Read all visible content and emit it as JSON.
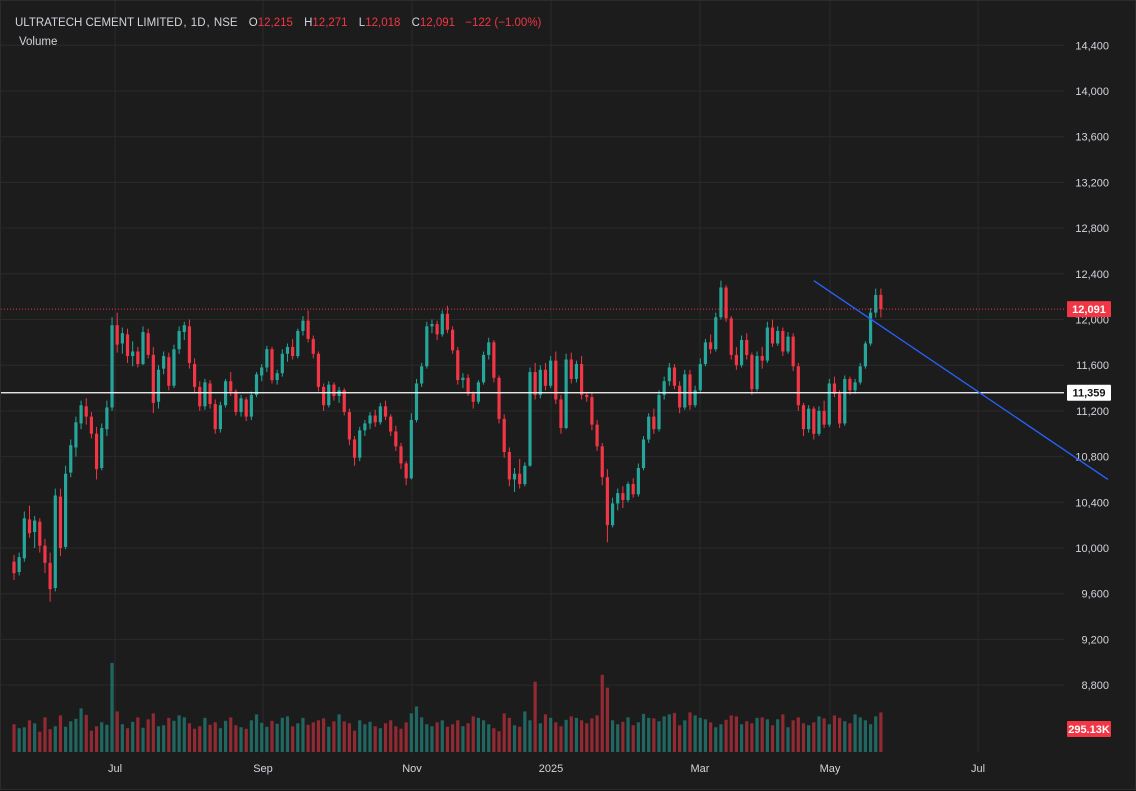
{
  "header": {
    "symbol": "ULTRATECH CEMENT LIMITED",
    "interval": "1D",
    "exchange": "NSE",
    "open_key": "O",
    "open": "12,215",
    "high_key": "H",
    "high": "12,271",
    "low_key": "L",
    "low": "12,018",
    "close_key": "C",
    "close": "12,091",
    "change": "−122 (−1.00%)",
    "volume_label": "Volume"
  },
  "badges": {
    "last_price": "12,091",
    "horizontal_line": "11,359",
    "volume": "295.13K"
  },
  "colors": {
    "up": "#26a69a",
    "down": "#f23645",
    "trendline": "#2962ff",
    "hline": "#ffffff",
    "background": "#1c1c1c",
    "grid": "#2a2a2a"
  },
  "chart_data": {
    "type": "candlestick",
    "title": "ULTRATECH CEMENT LIMITED, 1D, NSE",
    "ylabel": "",
    "xlabel": "",
    "ylim": [
      9000,
      14600
    ],
    "y_ticks": [
      "14,400",
      "14,000",
      "13,600",
      "13,200",
      "12,800",
      "12,400",
      "12,000",
      "11,600",
      "11,200",
      "10,800",
      "10,400",
      "10,000",
      "9,600",
      "9,200",
      "8,800"
    ],
    "x_ticks": [
      "Jul",
      "Sep",
      "Nov",
      "2025",
      "Mar",
      "May",
      "Jul"
    ],
    "last_close": 12091,
    "horizontal_line": 11359,
    "trendline": {
      "from": [
        155,
        12340
      ],
      "to": [
        212,
        10600
      ]
    },
    "grid": true,
    "candles": [
      [
        9880,
        9940,
        9720,
        9780
      ],
      [
        9790,
        9960,
        9760,
        9920
      ],
      [
        9910,
        10320,
        9880,
        10260
      ],
      [
        10250,
        10370,
        10090,
        10130
      ],
      [
        10140,
        10280,
        10000,
        10240
      ],
      [
        10230,
        10260,
        9960,
        10020
      ],
      [
        10020,
        10080,
        9780,
        9870
      ],
      [
        9870,
        9960,
        9530,
        9640
      ],
      [
        9650,
        10520,
        9620,
        10460
      ],
      [
        10450,
        10520,
        9930,
        10000
      ],
      [
        10010,
        10720,
        9990,
        10650
      ],
      [
        10660,
        10950,
        10620,
        10900
      ],
      [
        10880,
        11150,
        10800,
        11100
      ],
      [
        11090,
        11290,
        11040,
        11250
      ],
      [
        11240,
        11310,
        11080,
        11150
      ],
      [
        11150,
        11190,
        10960,
        11000
      ],
      [
        11000,
        11060,
        10600,
        10690
      ],
      [
        10700,
        11090,
        10680,
        11050
      ],
      [
        11040,
        11290,
        10980,
        11230
      ],
      [
        11230,
        12020,
        11200,
        11950
      ],
      [
        11950,
        12060,
        11710,
        11780
      ],
      [
        11790,
        11930,
        11700,
        11880
      ],
      [
        11870,
        11920,
        11620,
        11680
      ],
      [
        11680,
        11810,
        11590,
        11720
      ],
      [
        11720,
        11760,
        11580,
        11610
      ],
      [
        11610,
        11940,
        11600,
        11890
      ],
      [
        11880,
        11920,
        11660,
        11690
      ],
      [
        11690,
        11760,
        11180,
        11270
      ],
      [
        11280,
        11600,
        11220,
        11560
      ],
      [
        11570,
        11720,
        11520,
        11680
      ],
      [
        11670,
        11710,
        11380,
        11420
      ],
      [
        11420,
        11780,
        11400,
        11740
      ],
      [
        11740,
        11940,
        11700,
        11900
      ],
      [
        11890,
        11980,
        11820,
        11950
      ],
      [
        11940,
        12000,
        11570,
        11620
      ],
      [
        11610,
        11660,
        11360,
        11410
      ],
      [
        11410,
        11460,
        11200,
        11240
      ],
      [
        11240,
        11480,
        11210,
        11450
      ],
      [
        11440,
        11470,
        11220,
        11260
      ],
      [
        11260,
        11300,
        11000,
        11040
      ],
      [
        11040,
        11280,
        11010,
        11250
      ],
      [
        11250,
        11480,
        11230,
        11460
      ],
      [
        11460,
        11540,
        11330,
        11370
      ],
      [
        11370,
        11390,
        11160,
        11190
      ],
      [
        11190,
        11340,
        11150,
        11310
      ],
      [
        11300,
        11320,
        11110,
        11150
      ],
      [
        11150,
        11370,
        11120,
        11340
      ],
      [
        11340,
        11540,
        11320,
        11520
      ],
      [
        11510,
        11610,
        11460,
        11580
      ],
      [
        11580,
        11770,
        11540,
        11740
      ],
      [
        11740,
        11760,
        11440,
        11470
      ],
      [
        11470,
        11560,
        11430,
        11530
      ],
      [
        11530,
        11740,
        11500,
        11700
      ],
      [
        11700,
        11790,
        11630,
        11760
      ],
      [
        11760,
        11830,
        11650,
        11680
      ],
      [
        11680,
        11920,
        11660,
        11900
      ],
      [
        11900,
        12030,
        11860,
        11990
      ],
      [
        11990,
        12080,
        11800,
        11830
      ],
      [
        11830,
        11860,
        11660,
        11700
      ],
      [
        11700,
        11720,
        11370,
        11410
      ],
      [
        11410,
        11440,
        11200,
        11250
      ],
      [
        11250,
        11460,
        11230,
        11430
      ],
      [
        11430,
        11450,
        11290,
        11330
      ],
      [
        11330,
        11410,
        11270,
        11380
      ],
      [
        11380,
        11400,
        11160,
        11190
      ],
      [
        11190,
        11220,
        10900,
        10950
      ],
      [
        10950,
        10980,
        10720,
        10790
      ],
      [
        10790,
        11060,
        10760,
        11030
      ],
      [
        11030,
        11120,
        10980,
        11090
      ],
      [
        11090,
        11190,
        11040,
        11160
      ],
      [
        11160,
        11210,
        11060,
        11100
      ],
      [
        11100,
        11270,
        11080,
        11240
      ],
      [
        11240,
        11290,
        11120,
        11150
      ],
      [
        11150,
        11170,
        10980,
        11020
      ],
      [
        11020,
        11070,
        10850,
        10890
      ],
      [
        10890,
        10920,
        10690,
        10740
      ],
      [
        10740,
        10760,
        10550,
        10610
      ],
      [
        10610,
        11180,
        10600,
        11120
      ],
      [
        11120,
        11480,
        11100,
        11440
      ],
      [
        11440,
        11620,
        11410,
        11590
      ],
      [
        11590,
        11980,
        11570,
        11940
      ],
      [
        11940,
        12000,
        11880,
        11960
      ],
      [
        11960,
        11990,
        11820,
        11870
      ],
      [
        11870,
        12080,
        11850,
        12050
      ],
      [
        12050,
        12120,
        11880,
        11910
      ],
      [
        11910,
        11940,
        11700,
        11730
      ],
      [
        11730,
        11760,
        11430,
        11470
      ],
      [
        11470,
        11530,
        11400,
        11490
      ],
      [
        11490,
        11520,
        11330,
        11350
      ],
      [
        11350,
        11370,
        11220,
        11280
      ],
      [
        11280,
        11470,
        11260,
        11450
      ],
      [
        11450,
        11720,
        11430,
        11690
      ],
      [
        11690,
        11840,
        11650,
        11800
      ],
      [
        11800,
        11820,
        11450,
        11490
      ],
      [
        11490,
        11510,
        11090,
        11130
      ],
      [
        11130,
        11170,
        10790,
        10840
      ],
      [
        10840,
        10880,
        10540,
        10600
      ],
      [
        10600,
        10700,
        10490,
        10650
      ],
      [
        10650,
        10780,
        10520,
        10560
      ],
      [
        10560,
        10750,
        10540,
        10720
      ],
      [
        10720,
        11580,
        10710,
        11540
      ],
      [
        11540,
        11620,
        11300,
        11340
      ],
      [
        11340,
        11600,
        11310,
        11560
      ],
      [
        11560,
        11620,
        11380,
        11420
      ],
      [
        11420,
        11680,
        11400,
        11640
      ],
      [
        11640,
        11720,
        11260,
        11300
      ],
      [
        11300,
        11340,
        11000,
        11050
      ],
      [
        11050,
        11700,
        11040,
        11650
      ],
      [
        11650,
        11710,
        11440,
        11480
      ],
      [
        11480,
        11640,
        11450,
        11610
      ],
      [
        11610,
        11680,
        11300,
        11340
      ],
      [
        11340,
        11360,
        11280,
        11320
      ],
      [
        11320,
        11360,
        11030,
        11080
      ],
      [
        11080,
        11120,
        10850,
        10890
      ],
      [
        10890,
        10920,
        10550,
        10620
      ],
      [
        10620,
        10690,
        10050,
        10200
      ],
      [
        10200,
        10440,
        10180,
        10390
      ],
      [
        10390,
        10520,
        10330,
        10480
      ],
      [
        10480,
        10540,
        10350,
        10420
      ],
      [
        10420,
        10580,
        10400,
        10560
      ],
      [
        10560,
        10610,
        10440,
        10470
      ],
      [
        10470,
        10740,
        10450,
        10700
      ],
      [
        10700,
        10980,
        10680,
        10950
      ],
      [
        10950,
        11180,
        10920,
        11150
      ],
      [
        11150,
        11220,
        11000,
        11040
      ],
      [
        11040,
        11380,
        11020,
        11340
      ],
      [
        11340,
        11500,
        11300,
        11460
      ],
      [
        11460,
        11620,
        11420,
        11580
      ],
      [
        11580,
        11610,
        11390,
        11420
      ],
      [
        11420,
        11460,
        11180,
        11230
      ],
      [
        11230,
        11560,
        11210,
        11520
      ],
      [
        11520,
        11560,
        11210,
        11250
      ],
      [
        11250,
        11420,
        11230,
        11380
      ],
      [
        11380,
        11660,
        11360,
        11610
      ],
      [
        11610,
        11830,
        11590,
        11800
      ],
      [
        11800,
        11870,
        11700,
        11740
      ],
      [
        11740,
        12060,
        11720,
        12020
      ],
      [
        12020,
        12340,
        12000,
        12280
      ],
      [
        12280,
        12300,
        11980,
        12010
      ],
      [
        12010,
        12030,
        11650,
        11690
      ],
      [
        11690,
        11760,
        11560,
        11600
      ],
      [
        11600,
        11860,
        11580,
        11820
      ],
      [
        11820,
        11880,
        11650,
        11690
      ],
      [
        11690,
        11710,
        11340,
        11390
      ],
      [
        11390,
        11720,
        11370,
        11680
      ],
      [
        11680,
        11760,
        11570,
        11640
      ],
      [
        11640,
        11980,
        11620,
        11930
      ],
      [
        11930,
        12000,
        11760,
        11790
      ],
      [
        11790,
        11940,
        11770,
        11900
      ],
      [
        11900,
        11930,
        11680,
        11720
      ],
      [
        11720,
        11890,
        11700,
        11850
      ],
      [
        11850,
        11880,
        11550,
        11590
      ],
      [
        11590,
        11620,
        11200,
        11250
      ],
      [
        11250,
        11270,
        10980,
        11040
      ],
      [
        11040,
        11250,
        11010,
        11220
      ],
      [
        11220,
        11240,
        10950,
        11000
      ],
      [
        11000,
        11240,
        10980,
        11200
      ],
      [
        11200,
        11290,
        11050,
        11080
      ],
      [
        11080,
        11480,
        11060,
        11440
      ],
      [
        11440,
        11500,
        11320,
        11350
      ],
      [
        11350,
        11380,
        11050,
        11090
      ],
      [
        11090,
        11510,
        11070,
        11480
      ],
      [
        11480,
        11500,
        11340,
        11380
      ],
      [
        11380,
        11480,
        11350,
        11450
      ],
      [
        11450,
        11620,
        11430,
        11590
      ],
      [
        11590,
        11810,
        11570,
        11790
      ],
      [
        11790,
        12100,
        11770,
        12060
      ],
      [
        12060,
        12271,
        12018,
        12215
      ],
      [
        12215,
        12271,
        12018,
        12091
      ]
    ],
    "volume_k": [
      560,
      480,
      500,
      640,
      580,
      410,
      700,
      460,
      520,
      740,
      510,
      620,
      670,
      880,
      750,
      430,
      520,
      600,
      550,
      1800,
      820,
      560,
      480,
      610,
      700,
      490,
      660,
      780,
      520,
      540,
      690,
      630,
      740,
      700,
      580,
      470,
      520,
      690,
      550,
      600,
      480,
      630,
      700,
      540,
      500,
      470,
      640,
      760,
      590,
      510,
      630,
      570,
      690,
      720,
      520,
      580,
      690,
      550,
      600,
      640,
      680,
      510,
      620,
      760,
      620,
      580,
      430,
      640,
      560,
      610,
      520,
      480,
      580,
      640,
      520,
      470,
      600,
      780,
      920,
      700,
      560,
      520,
      600,
      640,
      510,
      560,
      640,
      520,
      580,
      720,
      690,
      640,
      560,
      480,
      420,
      780,
      690,
      540,
      510,
      820,
      640,
      1420,
      580,
      760,
      690,
      600,
      520,
      650,
      720,
      690,
      640,
      580,
      680,
      740,
      1560,
      1300,
      640,
      560,
      610,
      700,
      540,
      600,
      770,
      690,
      680,
      620,
      720,
      760,
      790,
      540,
      640,
      800,
      740,
      690,
      660,
      600,
      500,
      560,
      650,
      740,
      720,
      560,
      620,
      580,
      690,
      700,
      660,
      540,
      660,
      760,
      500,
      640,
      700,
      580,
      540,
      600,
      720,
      680,
      560,
      740,
      690,
      620,
      580,
      760,
      700,
      640,
      560,
      720,
      800
    ]
  }
}
